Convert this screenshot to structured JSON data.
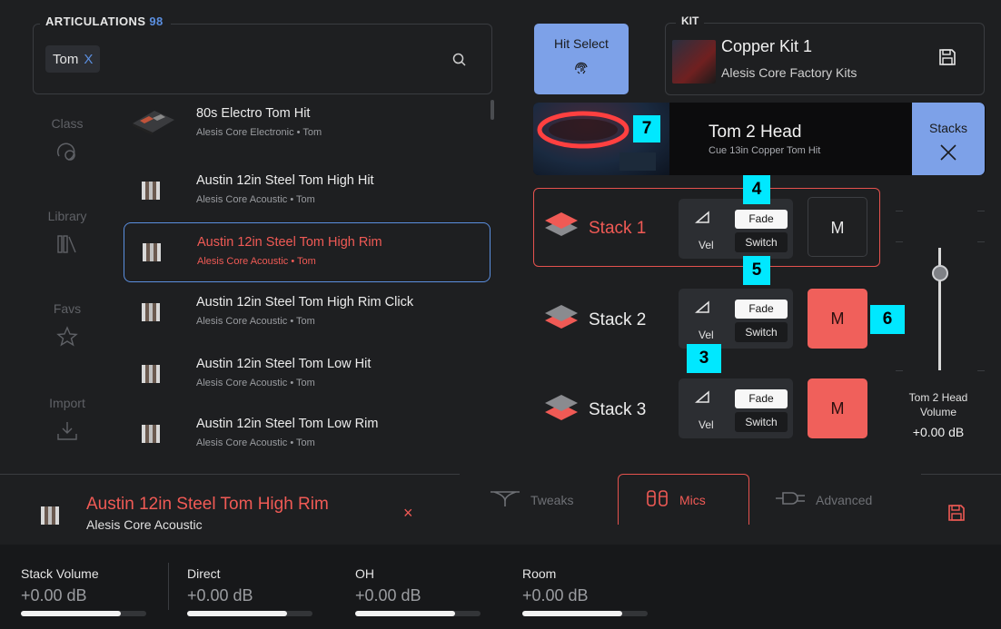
{
  "articulations": {
    "title": "ARTICULATIONS",
    "count": "98",
    "search_tag": "Tom",
    "search_tag_remove": "X"
  },
  "sidebar": {
    "items": [
      {
        "label": "Class",
        "icon": "class-icon"
      },
      {
        "label": "Library",
        "icon": "library-icon"
      },
      {
        "label": "Favs",
        "icon": "star-icon"
      },
      {
        "label": "Import",
        "icon": "import-icon"
      }
    ]
  },
  "list": [
    {
      "title": "80s Electro Tom Hit",
      "sub": "Alesis Core Electronic • Tom",
      "selected": false
    },
    {
      "title": "Austin 12in Steel Tom High Hit",
      "sub": "Alesis Core Acoustic • Tom",
      "selected": false
    },
    {
      "title": "Austin 12in Steel Tom High Rim",
      "sub": "Alesis Core Acoustic • Tom",
      "selected": true
    },
    {
      "title": "Austin 12in Steel Tom High Rim Click",
      "sub": "Alesis Core Acoustic • Tom",
      "selected": false
    },
    {
      "title": "Austin 12in Steel Tom Low Hit",
      "sub": "Alesis Core Acoustic • Tom",
      "selected": false
    },
    {
      "title": "Austin 12in Steel Tom Low Rim",
      "sub": "Alesis Core Acoustic • Tom",
      "selected": false
    }
  ],
  "hit_select": {
    "label": "Hit Select"
  },
  "kit": {
    "title": "KIT",
    "name": "Copper Kit 1",
    "library": "Alesis Core Factory Kits"
  },
  "cue": {
    "name": "Tom 2 Head",
    "sub": "Cue 13in Copper Tom Hit"
  },
  "stacks_button": {
    "label": "Stacks"
  },
  "stacks": [
    {
      "label": "Stack 1",
      "active": true,
      "vel": "Vel",
      "fade": "Fade",
      "switch": "Switch",
      "mute": "M",
      "muted": false
    },
    {
      "label": "Stack 2",
      "active": false,
      "vel": "Vel",
      "fade": "Fade",
      "switch": "Switch",
      "mute": "M",
      "muted": true
    },
    {
      "label": "Stack 3",
      "active": false,
      "vel": "Vel",
      "fade": "Fade",
      "switch": "Switch",
      "mute": "M",
      "muted": true
    }
  ],
  "callouts": [
    "7",
    "4",
    "5",
    "6",
    "3"
  ],
  "volume": {
    "label": "Tom 2 Head\nVolume",
    "value": "+0.00 dB",
    "level": 0.79
  },
  "selected": {
    "name": "Austin 12in Steel Tom High Rim",
    "library": "Alesis Core Acoustic",
    "close": "×"
  },
  "tabs": [
    {
      "label": "Tweaks",
      "active": false
    },
    {
      "label": "Mics",
      "active": true
    },
    {
      "label": "Advanced",
      "active": false
    }
  ],
  "mixer": [
    {
      "label": "Stack Volume",
      "value": "+0.00 dB",
      "level": 0.8
    },
    {
      "label": "Direct",
      "value": "+0.00 dB",
      "level": 0.8
    },
    {
      "label": "OH",
      "value": "+0.00 dB",
      "level": 0.8
    },
    {
      "label": "Room",
      "value": "+0.00 dB",
      "level": 0.8
    }
  ],
  "colors": {
    "accent_blue": "#7da1e8",
    "accent_red": "#f05a55",
    "callout": "#00e8ff"
  }
}
